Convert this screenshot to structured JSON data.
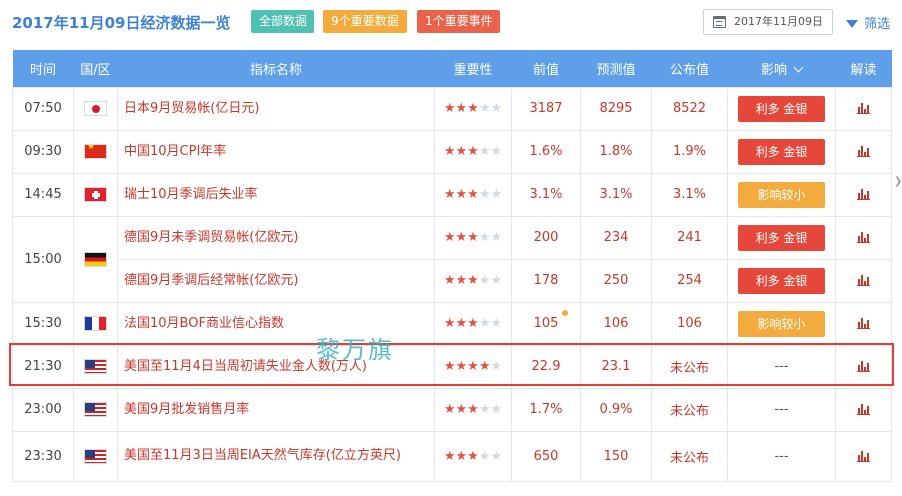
{
  "header": {
    "title": "2017年11月09日经济数据一览",
    "chips": {
      "all": "全部数据",
      "important_data": "9个重要数据",
      "important_events": "1个重要事件"
    },
    "date_value": "2017年11月09日",
    "filter_label": "筛选"
  },
  "table": {
    "columns": {
      "time": "时间",
      "country": "国/区",
      "indicator": "指标名称",
      "importance": "重要性",
      "previous": "前值",
      "forecast": "预测值",
      "actual": "公布值",
      "impact": "影响",
      "analysis": "解读"
    },
    "rows": [
      {
        "time": "07:50",
        "flag": "jp",
        "name": "日本9月贸易帐(亿日元)",
        "stars": 3,
        "previous": "3187",
        "forecast": "8295",
        "actual": "8522",
        "impact": "利多 金银",
        "impact_type": "bull"
      },
      {
        "time": "09:30",
        "flag": "cn",
        "name": "中国10月CPI年率",
        "stars": 3,
        "previous": "1.6%",
        "forecast": "1.8%",
        "actual": "1.9%",
        "impact": "利多 金银",
        "impact_type": "bull"
      },
      {
        "time": "14:45",
        "flag": "ch",
        "name": "瑞士10月季调后失业率",
        "stars": 3,
        "previous": "3.1%",
        "forecast": "3.1%",
        "actual": "3.1%",
        "impact": "影响较小",
        "impact_type": "small"
      },
      {
        "time": "15:00",
        "flag": "de",
        "name": "德国9月未季调贸易帐(亿欧元)",
        "stars": 3,
        "previous": "200",
        "forecast": "234",
        "actual": "241",
        "impact": "利多 金银",
        "impact_type": "bull"
      },
      {
        "time": "",
        "flag": "",
        "name": "德国9月季调后经常帐(亿欧元)",
        "stars": 3,
        "previous": "178",
        "forecast": "250",
        "actual": "254",
        "impact": "利多 金银",
        "impact_type": "bull"
      },
      {
        "time": "15:30",
        "flag": "fr",
        "name": "法国10月BOF商业信心指数",
        "stars": 3,
        "previous": "105",
        "forecast": "106",
        "actual": "106",
        "impact": "影响较小",
        "impact_type": "small"
      },
      {
        "time": "21:30",
        "flag": "us",
        "name": "美国至11月4日当周初请失业金人数(万人)",
        "stars": 4,
        "previous": "22.9",
        "forecast": "23.1",
        "actual": "未公布",
        "impact": "---",
        "impact_type": "none"
      },
      {
        "time": "23:00",
        "flag": "us",
        "name": "美国9月批发销售月率",
        "stars": 3,
        "previous": "1.7%",
        "forecast": "0.9%",
        "actual": "未公布",
        "impact": "---",
        "impact_type": "none"
      },
      {
        "time": "23:30",
        "flag": "us",
        "name": "美国至11月3日当周EIA天然气库存(亿立方英尺)",
        "stars": 3,
        "previous": "650",
        "forecast": "150",
        "actual": "未公布",
        "impact": "---",
        "impact_type": "none"
      }
    ]
  },
  "watermark": "黎万旗",
  "colors": {
    "header_bg": "#5f9fea",
    "bull": "#e5483a",
    "small": "#f3ab3d",
    "highlight": "#e23f33"
  }
}
